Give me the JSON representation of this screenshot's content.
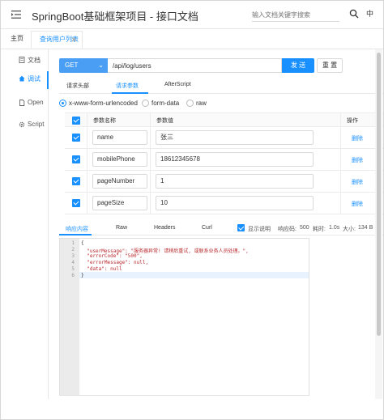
{
  "header": {
    "title": "SpringBoot基础框架项目 - 接口文档",
    "search_placeholder": "输入文档关键字搜索",
    "lang": "中"
  },
  "tabs": {
    "home": "主页",
    "active": "查询用户列表",
    "close": "✕"
  },
  "sidebar": {
    "items": [
      {
        "label": "文档",
        "icon": "document-icon"
      },
      {
        "label": "调试",
        "icon": "home-icon"
      },
      {
        "label": "Open",
        "icon": "file-icon"
      },
      {
        "label": "Script",
        "icon": "gear-icon"
      }
    ]
  },
  "request": {
    "method": "GET",
    "url": "/api/log/users",
    "send_label": "发 送",
    "reset_label": "重 置",
    "tabs": [
      "请求头部",
      "请求参数",
      "AfterScript"
    ],
    "content_types": [
      "x-www-form-urlencoded",
      "form-data",
      "raw"
    ]
  },
  "params": {
    "headers": {
      "name": "参数名称",
      "value": "参数值",
      "op": "操作"
    },
    "delete_label": "删除",
    "rows": [
      {
        "name": "name",
        "value": "张三"
      },
      {
        "name": "mobilePhone",
        "value": "18612345678"
      },
      {
        "name": "pageNumber",
        "value": "1"
      },
      {
        "name": "pageSize",
        "value": "10"
      }
    ]
  },
  "response": {
    "tabs": [
      "响应内容",
      "Raw",
      "Headers",
      "Curl"
    ],
    "show_desc": "显示说明",
    "code_label": "响应码:",
    "code": "500",
    "time_label": "耗时:",
    "time": "1.0s",
    "size_label": "大小:",
    "size": "134 B",
    "line_numbers": [
      "1",
      "2",
      "3",
      "4",
      "5",
      "6"
    ],
    "lines": [
      "{",
      "  \"userMessage\": \"服务器异常! 请稍后重试, 或联系业务人员处理。\",",
      "  \"errorCode\": \"500\",",
      "  \"errorMessage\": null,",
      "  \"data\": null",
      "}"
    ]
  },
  "colors": {
    "accent": "#1890ff",
    "success": "#52c41a"
  }
}
